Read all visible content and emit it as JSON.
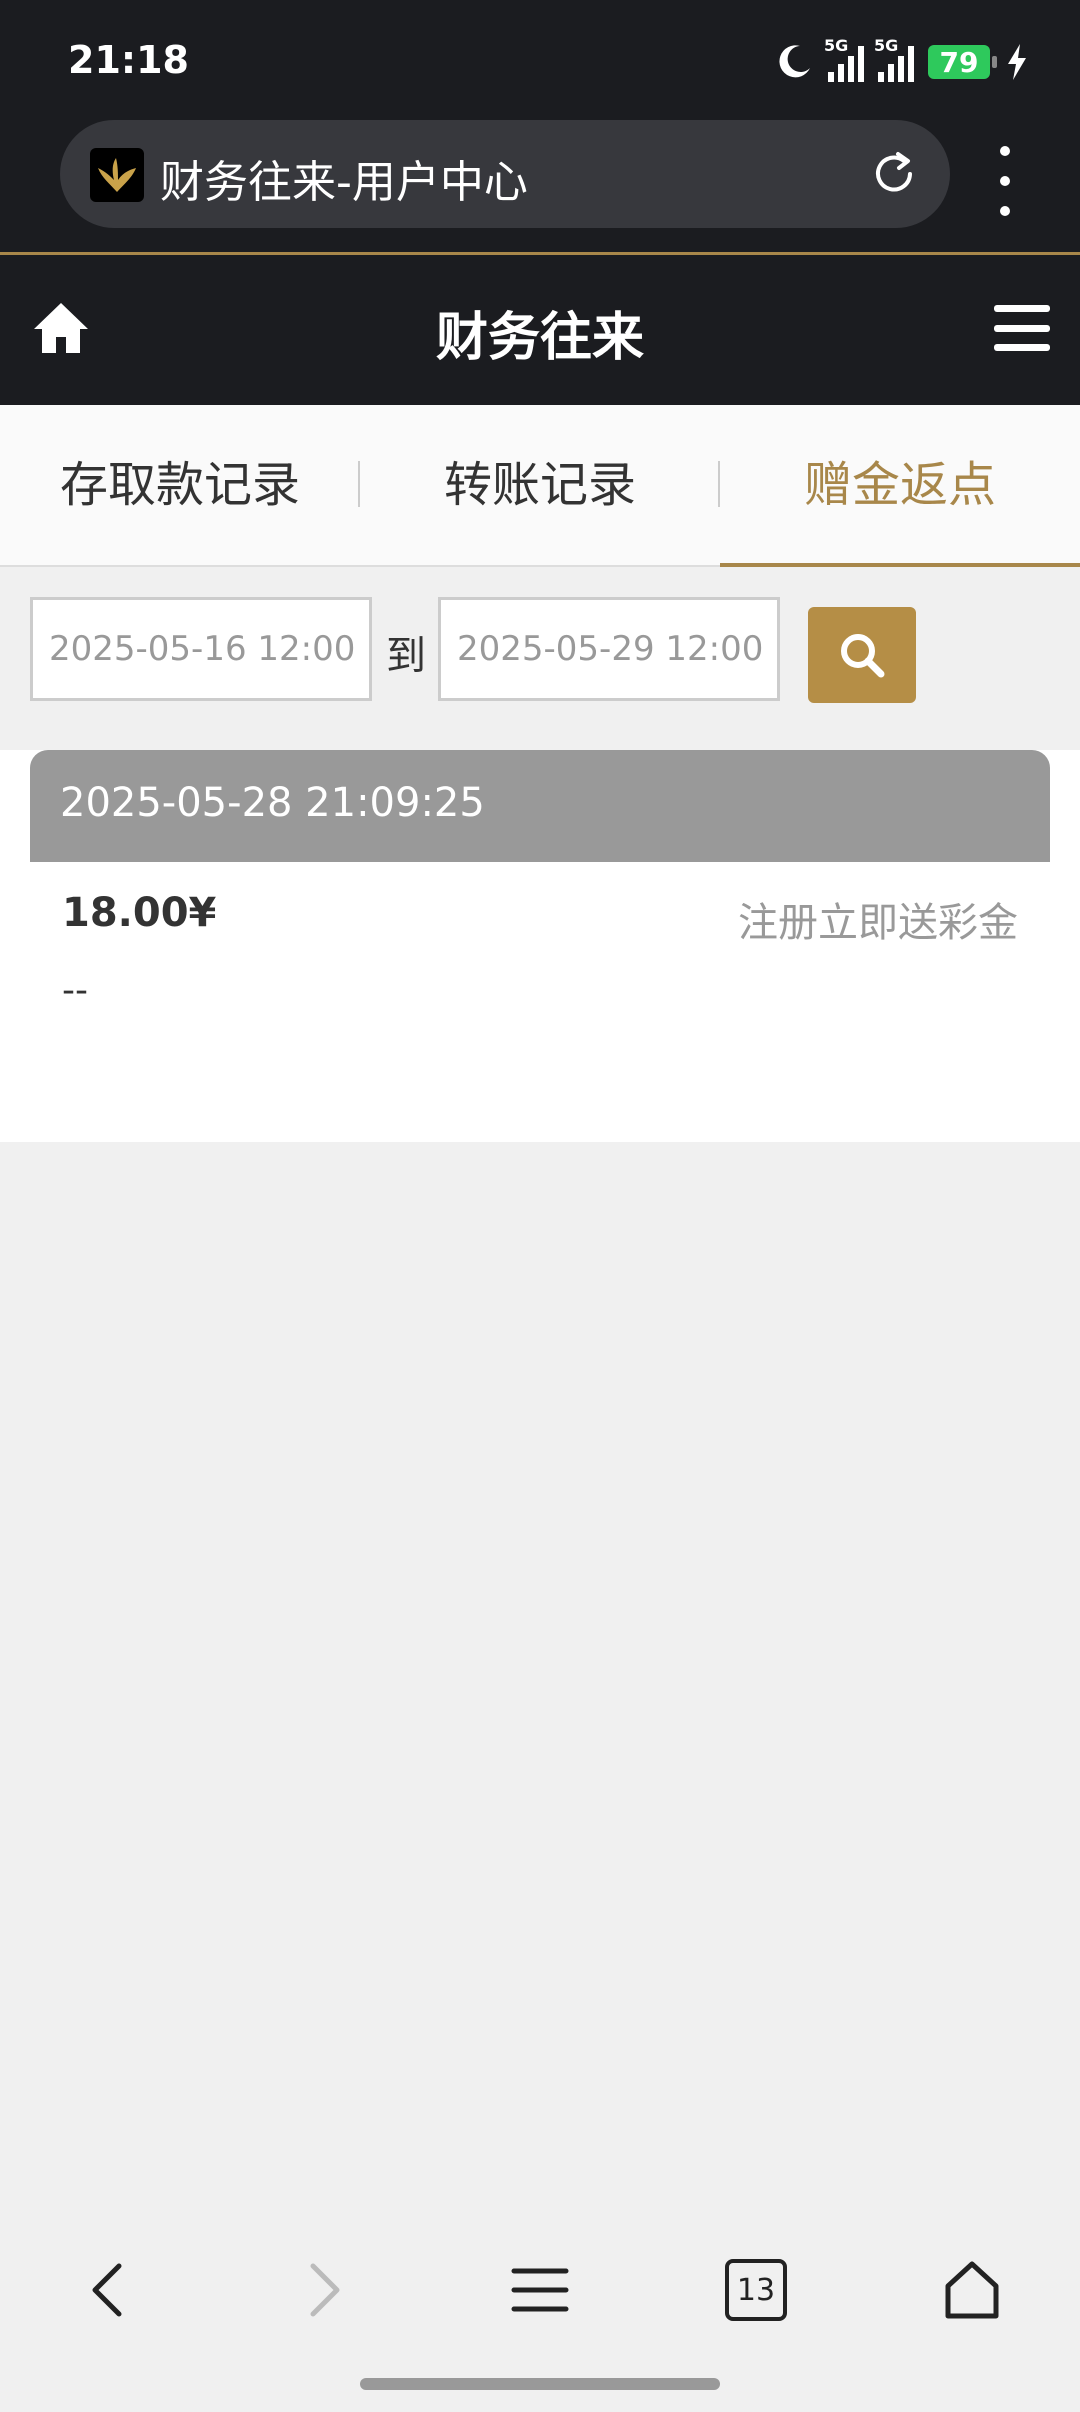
{
  "status_bar": {
    "time": "21:18",
    "network_1": "5G",
    "network_2": "5G",
    "battery": "79",
    "icons": [
      "moon-icon",
      "signal-icon",
      "signal-icon",
      "battery-icon",
      "charging-icon"
    ]
  },
  "browser": {
    "url_title": "财务往来-用户中心",
    "icons": [
      "favicon-icon",
      "reload-icon",
      "more-icon"
    ]
  },
  "header": {
    "title": "财务往来",
    "icons": [
      "home-icon",
      "menu-icon"
    ]
  },
  "tabs": [
    {
      "label": "存取款记录"
    },
    {
      "label": "转账记录"
    },
    {
      "label": "赠金返点"
    }
  ],
  "filter": {
    "from_value": "2025-05-16 12:00",
    "to_label": "到",
    "to_value": "2025-05-29 12:00"
  },
  "records": [
    {
      "datetime": "2025-05-28 21:09:25",
      "amount": "18.00¥",
      "description": "注册立即送彩金",
      "note": "--"
    }
  ],
  "navbar": {
    "tab_count": "13",
    "icons": [
      "back-icon",
      "forward-icon",
      "menu-lines-icon",
      "tabs-icon",
      "home-outline-icon"
    ]
  },
  "colors": {
    "accent": "#a8874a",
    "header_bg": "#1b1c20",
    "battery": "#2ec95c"
  }
}
